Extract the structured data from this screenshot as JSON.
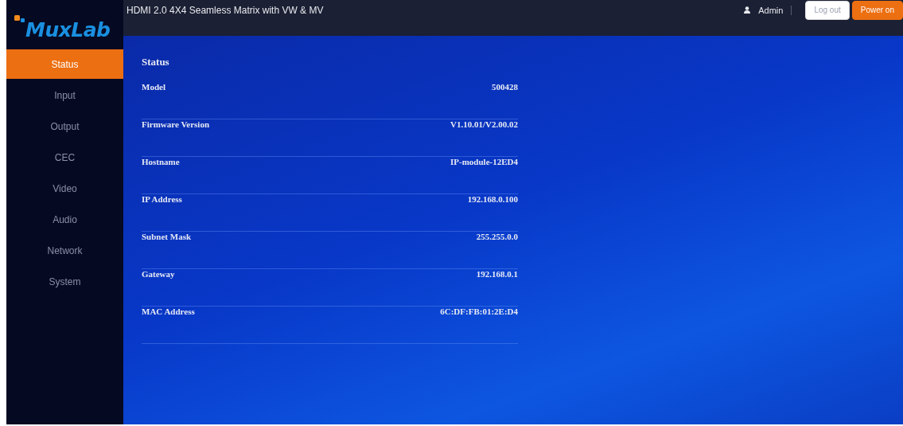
{
  "logo": "MuxLab",
  "header": {
    "title": "HDMI 2.0 4X4 Seamless Matrix with VW & MV",
    "user": "Admin",
    "buttons": [
      {
        "label": "Log out",
        "kind": "plain"
      },
      {
        "label": "Power on",
        "kind": "accent"
      }
    ]
  },
  "sidebar": {
    "items": [
      {
        "label": "Status",
        "selected": true
      },
      {
        "label": "Input",
        "selected": false
      },
      {
        "label": "Output",
        "selected": false
      },
      {
        "label": "CEC",
        "selected": false
      },
      {
        "label": "Video",
        "selected": false
      },
      {
        "label": "Audio",
        "selected": false
      },
      {
        "label": "Network",
        "selected": false
      },
      {
        "label": "System",
        "selected": false
      }
    ]
  },
  "panel": {
    "title": "Status",
    "rows": [
      {
        "label": "Model",
        "value": "500428"
      },
      {
        "label": "Firmware Version",
        "value": "V1.10.01/V2.00.02"
      },
      {
        "label": "Hostname",
        "value": "IP-module-12ED4"
      },
      {
        "label": "IP Address",
        "value": "192.168.0.100"
      },
      {
        "label": "Subnet Mask",
        "value": "255.255.0.0"
      },
      {
        "label": "Gateway",
        "value": "192.168.0.1"
      },
      {
        "label": "MAC Address",
        "value": "6C:DF:FB:01:2E:D4"
      }
    ]
  }
}
